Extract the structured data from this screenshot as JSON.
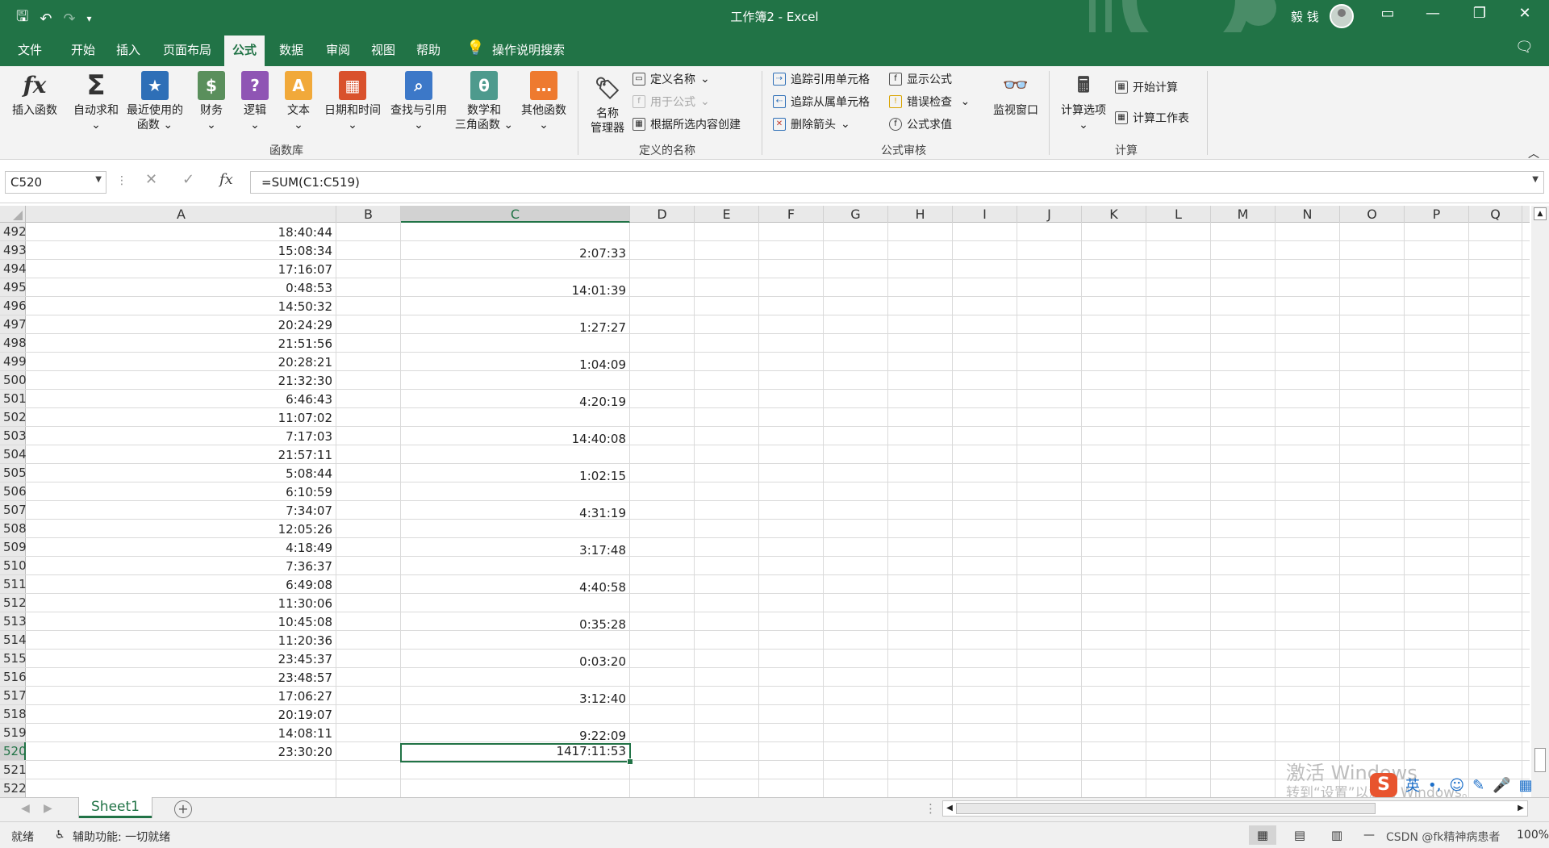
{
  "window": {
    "title": "工作簿2 - Excel",
    "user": "毅 钱",
    "accent": "#217346"
  },
  "tabs": [
    {
      "label": "文件"
    },
    {
      "label": "开始"
    },
    {
      "label": "插入"
    },
    {
      "label": "页面布局"
    },
    {
      "label": "公式",
      "active": true
    },
    {
      "label": "数据"
    },
    {
      "label": "审阅"
    },
    {
      "label": "视图"
    },
    {
      "label": "帮助"
    }
  ],
  "tell_me": "操作说明搜索",
  "ribbon": {
    "function_library": {
      "label": "函数库",
      "insert_function": "插入函数",
      "autosum": "自动求和",
      "recent": "最近使用的",
      "recent2": "函数",
      "financial": "财务",
      "logical": "逻辑",
      "text": "文本",
      "datetime": "日期和时间",
      "lookup": "查找与引用",
      "math": "数学和",
      "math2": "三角函数",
      "more": "其他函数"
    },
    "defined_names": {
      "label": "定义的名称",
      "name_manager": "名称",
      "name_manager2": "管理器",
      "define_name": "定义名称",
      "use_in_formula": "用于公式",
      "create_from_selection": "根据所选内容创建"
    },
    "auditing": {
      "label": "公式审核",
      "trace_precedents": "追踪引用单元格",
      "trace_dependents": "追踪从属单元格",
      "remove_arrows": "删除箭头",
      "show_formulas": "显示公式",
      "error_checking": "错误检查",
      "evaluate": "公式求值",
      "watch_window": "监视窗口"
    },
    "calculation": {
      "label": "计算",
      "options": "计算选项",
      "calc_now": "开始计算",
      "calc_sheet": "计算工作表"
    }
  },
  "formula_bar": {
    "name_box": "C520",
    "fx": "fx",
    "formula": "=SUM(C1:C519)"
  },
  "columns": [
    "A",
    "B",
    "C",
    "D",
    "E",
    "F",
    "G",
    "H",
    "I",
    "J",
    "K",
    "L",
    "M",
    "N",
    "O",
    "P",
    "Q"
  ],
  "selected_column": "C",
  "rows": [
    {
      "num": "492",
      "a": "18:40:44",
      "c": ""
    },
    {
      "num": "493",
      "a": "15:08:34",
      "c": "2:07:33"
    },
    {
      "num": "494",
      "a": "17:16:07",
      "c": ""
    },
    {
      "num": "495",
      "a": "0:48:53",
      "c": "14:01:39"
    },
    {
      "num": "496",
      "a": "14:50:32",
      "c": ""
    },
    {
      "num": "497",
      "a": "20:24:29",
      "c": "1:27:27"
    },
    {
      "num": "498",
      "a": "21:51:56",
      "c": ""
    },
    {
      "num": "499",
      "a": "20:28:21",
      "c": "1:04:09"
    },
    {
      "num": "500",
      "a": "21:32:30",
      "c": ""
    },
    {
      "num": "501",
      "a": "6:46:43",
      "c": "4:20:19"
    },
    {
      "num": "502",
      "a": "11:07:02",
      "c": ""
    },
    {
      "num": "503",
      "a": "7:17:03",
      "c": "14:40:08"
    },
    {
      "num": "504",
      "a": "21:57:11",
      "c": ""
    },
    {
      "num": "505",
      "a": "5:08:44",
      "c": "1:02:15"
    },
    {
      "num": "506",
      "a": "6:10:59",
      "c": ""
    },
    {
      "num": "507",
      "a": "7:34:07",
      "c": "4:31:19"
    },
    {
      "num": "508",
      "a": "12:05:26",
      "c": ""
    },
    {
      "num": "509",
      "a": "4:18:49",
      "c": "3:17:48"
    },
    {
      "num": "510",
      "a": "7:36:37",
      "c": ""
    },
    {
      "num": "511",
      "a": "6:49:08",
      "c": "4:40:58"
    },
    {
      "num": "512",
      "a": "11:30:06",
      "c": ""
    },
    {
      "num": "513",
      "a": "10:45:08",
      "c": "0:35:28"
    },
    {
      "num": "514",
      "a": "11:20:36",
      "c": ""
    },
    {
      "num": "515",
      "a": "23:45:37",
      "c": "0:03:20"
    },
    {
      "num": "516",
      "a": "23:48:57",
      "c": ""
    },
    {
      "num": "517",
      "a": "17:06:27",
      "c": "3:12:40"
    },
    {
      "num": "518",
      "a": "20:19:07",
      "c": ""
    },
    {
      "num": "519",
      "a": "14:08:11",
      "c": "9:22:09"
    },
    {
      "num": "520",
      "a": "23:30:20",
      "c": "1417:11:53",
      "selected": true
    },
    {
      "num": "521",
      "a": "",
      "c": ""
    },
    {
      "num": "522",
      "a": "",
      "c": ""
    }
  ],
  "sheet_tab": "Sheet1",
  "watermark": {
    "line1": "激活 Windows",
    "line2": "转到“设置”以激活 Windows。"
  },
  "ime": {
    "lang": "英"
  },
  "status": {
    "ready": "就绪",
    "accessibility": "辅助功能: 一切就绪",
    "zoom": "100%",
    "credit": "CSDN @fk精神病患者"
  }
}
